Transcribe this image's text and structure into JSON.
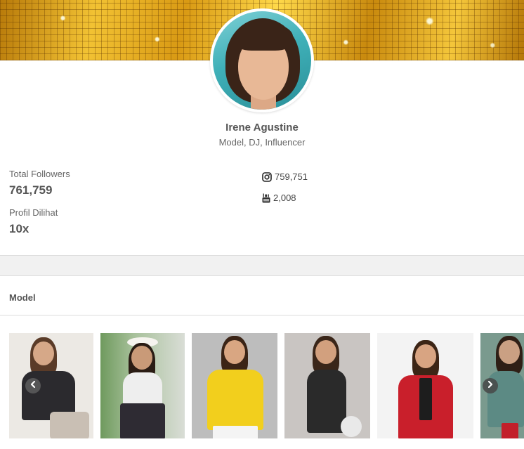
{
  "profile": {
    "name": "Irene Agustine",
    "role": "Model, DJ, Influencer"
  },
  "stats": {
    "followers_label": "Total Followers",
    "followers_value": "761,759",
    "views_label": "Profil Dilihat",
    "views_value": "10x"
  },
  "social": {
    "instagram": {
      "icon": "instagram-icon",
      "count": "759,751"
    },
    "youtube": {
      "icon": "youtube-icon",
      "count": "2,008"
    }
  },
  "section": {
    "title": "Model"
  },
  "gallery": {
    "photos": [
      {
        "description": "photo-1",
        "bg": "#ece9e4"
      },
      {
        "description": "photo-2",
        "bg": "#9fb89a"
      },
      {
        "description": "photo-3",
        "bg": "#bdbdbd"
      },
      {
        "description": "photo-4",
        "bg": "#c9c5c2"
      },
      {
        "description": "photo-5",
        "bg": "#f3f3f3"
      },
      {
        "description": "photo-6",
        "bg": "#7a9a8e"
      }
    ],
    "prev_icon": "chevron-left-icon",
    "next_icon": "chevron-right-icon"
  },
  "colors": {
    "banner_gold": "#e6b021",
    "text": "#555555",
    "divider": "#dddddd"
  }
}
